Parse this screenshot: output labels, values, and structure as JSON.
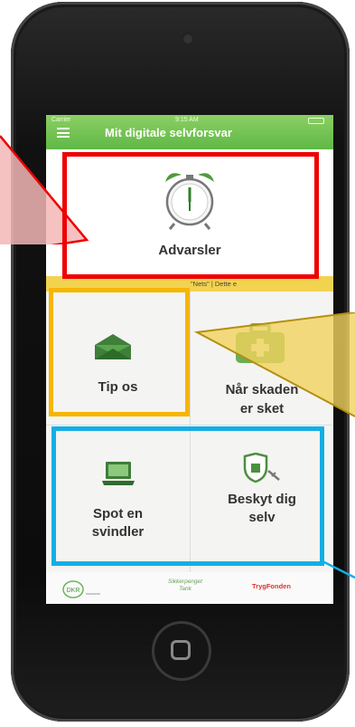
{
  "status_bar": {
    "carrier": "Carrier",
    "time": "9:15 AM"
  },
  "app": {
    "title": "Mit digitale selvforsvar"
  },
  "tiles": {
    "advarsler": {
      "label": "Advarsler",
      "icon": "alarm-clock-icon"
    },
    "tip_os": {
      "label": "Tip os",
      "icon": "envelope-icon"
    },
    "naar_skaden": {
      "label_line1": "Når skaden",
      "label_line2": "er sket",
      "icon": "first-aid-kit-icon"
    },
    "spot_svindler": {
      "label_line1": "Spot en",
      "label_line2": "svindler",
      "icon": "laptop-icon"
    },
    "beskyt": {
      "label_line1": "Beskyt dig",
      "label_line2": "selv",
      "icon": "shield-key-icon"
    }
  },
  "ticker": {
    "text": "\"Nets\"  |   Dette e"
  },
  "sponsors": [
    {
      "name": "DKR logo"
    },
    {
      "name_line1": "Sikkerpenget",
      "name_line2": "Tank"
    },
    {
      "name": "TrygFonden"
    }
  ],
  "colors": {
    "header_green": "#5fb845",
    "annotation_red": "#ee0000",
    "annotation_yellow": "#f7b500",
    "annotation_blue": "#14aee6",
    "ticker_yellow": "#f2d34f"
  }
}
